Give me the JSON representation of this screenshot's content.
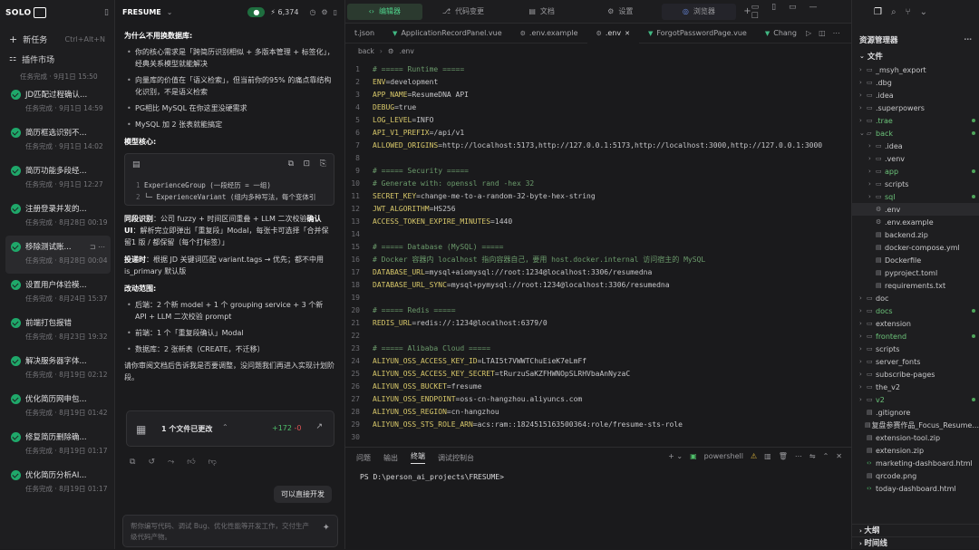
{
  "app": {
    "logo": "SOLO",
    "project": "FRESUME",
    "branch_badge": "● ",
    "stars": "6,374"
  },
  "sidebar": {
    "new_task": "新任务",
    "new_task_shortcut": "Ctrl+Alt+N",
    "plugin_market": "插件市场",
    "partial_task_time": "任务完成 · 9月1日 15:50",
    "tasks": [
      {
        "title": "JD匹配过程确认...",
        "time": "任务完成 · 9月1日 14:59"
      },
      {
        "title": "简历框选识别不...",
        "time": "任务完成 · 9月1日 14:02"
      },
      {
        "title": "简历功能多段经...",
        "time": "任务完成 · 9月1日 12:27"
      },
      {
        "title": "注册登录并发的...",
        "time": "任务完成 · 8月28日 00:19"
      },
      {
        "title": "移除测试账...",
        "time": "任务完成 · 8月28日 00:04"
      },
      {
        "title": "设置用户体验模...",
        "time": "任务完成 · 8月24日 15:37"
      },
      {
        "title": "前端打包报错",
        "time": "任务完成 · 8月23日 19:32"
      },
      {
        "title": "解决服务器字体...",
        "time": "任务完成 · 8月19日 02:12"
      },
      {
        "title": "优化简历网申包...",
        "time": "任务完成 · 8月19日 01:42"
      },
      {
        "title": "修复简历删除确...",
        "time": "任务完成 · 8月19日 01:17"
      },
      {
        "title": "优化简历分析AI...",
        "time": "任务完成 · 8月19日 01:17"
      }
    ]
  },
  "chat": {
    "heading1": "为什么不用换数据库:",
    "bullets1": [
      "你的核心需求是「跨简历识别相似 + 多版本管理 + 标签化」，经典关系模型就能解决",
      "向量库的价值在「语义检索」，但当前你的95% 的痛点靠结构化识别，不是语义检索",
      "PG相比 MySQL 在你这里没硬需求",
      "MySQL 加 2 张表就能搞定"
    ],
    "heading2": "模型核心:",
    "code1": "ExperienceGroup (一段经历 = 一组)",
    "code2": "└─ ExperienceVariant (组内多种写法，每个变体引",
    "p1_bold": "同段识别",
    "p1": "：公司 fuzzy + 时间区间重叠 + LLM 二次校验",
    "p1_bold2": "确认 UI",
    "p1b": "：解析完立即弹出「重复段」Modal，每张卡可选择「合并保留1 版 / 都保留（每个打标签）」",
    "p2_bold": "投递时",
    "p2": "：根据 JD 关键词匹配 variant.tags → 优先；都不中用 is_primary 默认版",
    "heading3": "改动范围:",
    "bullets3": [
      "后端：2 个新 model + 1 个 grouping service + 3 个新 API + LLM 二次校验 prompt",
      "前端：1 个「重复段确认」Modal",
      "数据库：2 张新表（CREATE，不迁移）"
    ],
    "p3": "请你审阅文档后告诉我是否要调整，没问题我们再进入实现计划阶段。",
    "files_changed": "1 个文件已更改",
    "added": "+172",
    "removed": "-0",
    "user_msg": "可以直接开发",
    "input_placeholder": "帮你编写代码、调试 Bug、优化性能等开发工作，交付生产级代码产物。"
  },
  "editor": {
    "top_tabs": [
      "编辑器",
      "代码变更",
      "文档",
      "设置",
      "浏览器"
    ],
    "file_tabs": [
      "t.json",
      "ApplicationRecordPanel.vue",
      ".env.example",
      ".env",
      "ForgotPasswordPage.vue",
      "Chang"
    ],
    "breadcrumb": [
      "back",
      ".env"
    ],
    "lines": [
      {
        "n": "1",
        "c": "# ===== Runtime =====",
        "t": "cm"
      },
      {
        "n": "2",
        "k": "ENV",
        "v": "development"
      },
      {
        "n": "3",
        "k": "APP_NAME",
        "v": "ResumeDNA API"
      },
      {
        "n": "4",
        "k": "DEBUG",
        "v": "true"
      },
      {
        "n": "5",
        "k": "LOG_LEVEL",
        "v": "INFO"
      },
      {
        "n": "6",
        "k": "API_V1_PREFIX",
        "v": "/api/v1"
      },
      {
        "n": "7",
        "k": "ALLOWED_ORIGINS",
        "v": "http://localhost:5173,http://127.0.0.1:5173,http://localhost:3000,http://127.0.0.1:3000"
      },
      {
        "n": "8",
        "c": ""
      },
      {
        "n": "9",
        "c": "# ===== Security =====",
        "t": "cm"
      },
      {
        "n": "10",
        "c": "# Generate with: openssl rand -hex 32",
        "t": "cm"
      },
      {
        "n": "11",
        "k": "SECRET_KEY",
        "v": "change-me-to-a-random-32-byte-hex-string"
      },
      {
        "n": "12",
        "k": "JWT_ALGORITHM",
        "v": "HS256"
      },
      {
        "n": "13",
        "k": "ACCESS_TOKEN_EXPIRE_MINUTES",
        "v": "1440"
      },
      {
        "n": "14",
        "c": ""
      },
      {
        "n": "15",
        "c": "# ===== Database (MySQL) =====",
        "t": "cm"
      },
      {
        "n": "16",
        "c": "# Docker 容器内 localhost 指向容器自己，要用 host.docker.internal 访问宿主的 MySQL",
        "t": "cm"
      },
      {
        "n": "17",
        "k": "DATABASE_URL",
        "v": "mysql+aiomysql://root:1234@localhost:3306/resumedna"
      },
      {
        "n": "18",
        "k": "DATABASE_URL_SYNC",
        "v": "mysql+pymysql://root:1234@localhost:3306/resumedna"
      },
      {
        "n": "19",
        "c": ""
      },
      {
        "n": "20",
        "c": "# ===== Redis =====",
        "t": "cm"
      },
      {
        "n": "21",
        "k": "REDIS_URL",
        "v": "redis://:1234@localhost:6379/0"
      },
      {
        "n": "22",
        "c": ""
      },
      {
        "n": "23",
        "c": "# ===== Alibaba Cloud =====",
        "t": "cm"
      },
      {
        "n": "24",
        "k": "ALIYUN_OSS_ACCESS_KEY_ID",
        "v": "LTAI5t7VWWTChuEieK7eLmFf"
      },
      {
        "n": "25",
        "k": "ALIYUN_OSS_ACCESS_KEY_SECRET",
        "v": "tRurzuSaKZFHWNOpSLRHVbaAnNyzaC"
      },
      {
        "n": "26",
        "k": "ALIYUN_OSS_BUCKET",
        "v": "fresume"
      },
      {
        "n": "27",
        "k": "ALIYUN_OSS_ENDPOINT",
        "v": "oss-cn-hangzhou.aliyuncs.com"
      },
      {
        "n": "28",
        "k": "ALIYUN_OSS_REGION",
        "v": "cn-hangzhou"
      },
      {
        "n": "29",
        "k": "ALIYUN_OSS_STS_ROLE_ARN",
        "v": "acs:ram::1824515163500364:role/fresume-sts-role"
      },
      {
        "n": "30",
        "c": ""
      }
    ],
    "term_tabs": [
      "问题",
      "输出",
      "终端",
      "调试控制台"
    ],
    "shell": "powershell",
    "prompt": "PS D:\\person_ai_projects\\FRESUME>"
  },
  "explorer": {
    "title": "资源管理器",
    "section": "文件",
    "rows": [
      {
        "name": "_msyh_export",
        "d": 1,
        "type": "folder",
        "dot": ""
      },
      {
        "name": ".dbg",
        "d": 1,
        "type": "folder",
        "dot": ""
      },
      {
        "name": ".idea",
        "d": 1,
        "type": "folder",
        "dot": ""
      },
      {
        "name": ".superpowers",
        "d": 1,
        "type": "folder",
        "dot": ""
      },
      {
        "name": ".trae",
        "d": 1,
        "type": "folder",
        "dot": "g"
      },
      {
        "name": "back",
        "d": 1,
        "type": "open",
        "dot": "g"
      },
      {
        "name": ".idea",
        "d": 2,
        "type": "folder",
        "dot": ""
      },
      {
        "name": ".venv",
        "d": 2,
        "type": "folder",
        "dot": ""
      },
      {
        "name": "app",
        "d": 2,
        "type": "folder",
        "dot": "g"
      },
      {
        "name": "scripts",
        "d": 2,
        "type": "folder",
        "dot": ""
      },
      {
        "name": "sql",
        "d": 2,
        "type": "folder",
        "dot": "g"
      },
      {
        "name": ".env",
        "d": 2,
        "type": "gear",
        "dot": ""
      },
      {
        "name": ".env.example",
        "d": 2,
        "type": "gear",
        "dot": ""
      },
      {
        "name": "backend.zip",
        "d": 2,
        "type": "file",
        "dot": ""
      },
      {
        "name": "docker-compose.yml",
        "d": 2,
        "type": "file",
        "dot": ""
      },
      {
        "name": "Dockerfile",
        "d": 2,
        "type": "file",
        "dot": ""
      },
      {
        "name": "pyproject.toml",
        "d": 2,
        "type": "file",
        "dot": ""
      },
      {
        "name": "requirements.txt",
        "d": 2,
        "type": "file",
        "dot": ""
      },
      {
        "name": "doc",
        "d": 1,
        "type": "folder",
        "dot": ""
      },
      {
        "name": "docs",
        "d": 1,
        "type": "folder",
        "dot": "g"
      },
      {
        "name": "extension",
        "d": 1,
        "type": "folder",
        "dot": ""
      },
      {
        "name": "frontend",
        "d": 1,
        "type": "folder",
        "dot": "g"
      },
      {
        "name": "scripts",
        "d": 1,
        "type": "folder",
        "dot": ""
      },
      {
        "name": "server_fonts",
        "d": 1,
        "type": "folder",
        "dot": ""
      },
      {
        "name": "subscribe-pages",
        "d": 1,
        "type": "folder",
        "dot": ""
      },
      {
        "name": "the_v2",
        "d": 1,
        "type": "folder",
        "dot": ""
      },
      {
        "name": "v2",
        "d": 1,
        "type": "folder",
        "dot": "g"
      },
      {
        "name": ".gitignore",
        "d": 1,
        "type": "file",
        "dot": ""
      },
      {
        "name": "复盘参赛作品_Focus_Resume...",
        "d": 1,
        "type": "file",
        "dot": ""
      },
      {
        "name": "extension-tool.zip",
        "d": 1,
        "type": "file",
        "dot": ""
      },
      {
        "name": "extension.zip",
        "d": 1,
        "type": "file",
        "dot": ""
      },
      {
        "name": "marketing-dashboard.html",
        "d": 1,
        "type": "code",
        "dot": ""
      },
      {
        "name": "qrcode.png",
        "d": 1,
        "type": "file",
        "dot": ""
      },
      {
        "name": "today-dashboard.html",
        "d": 1,
        "type": "code",
        "dot": ""
      }
    ],
    "outline": "大纲",
    "timeline": "时间线"
  }
}
